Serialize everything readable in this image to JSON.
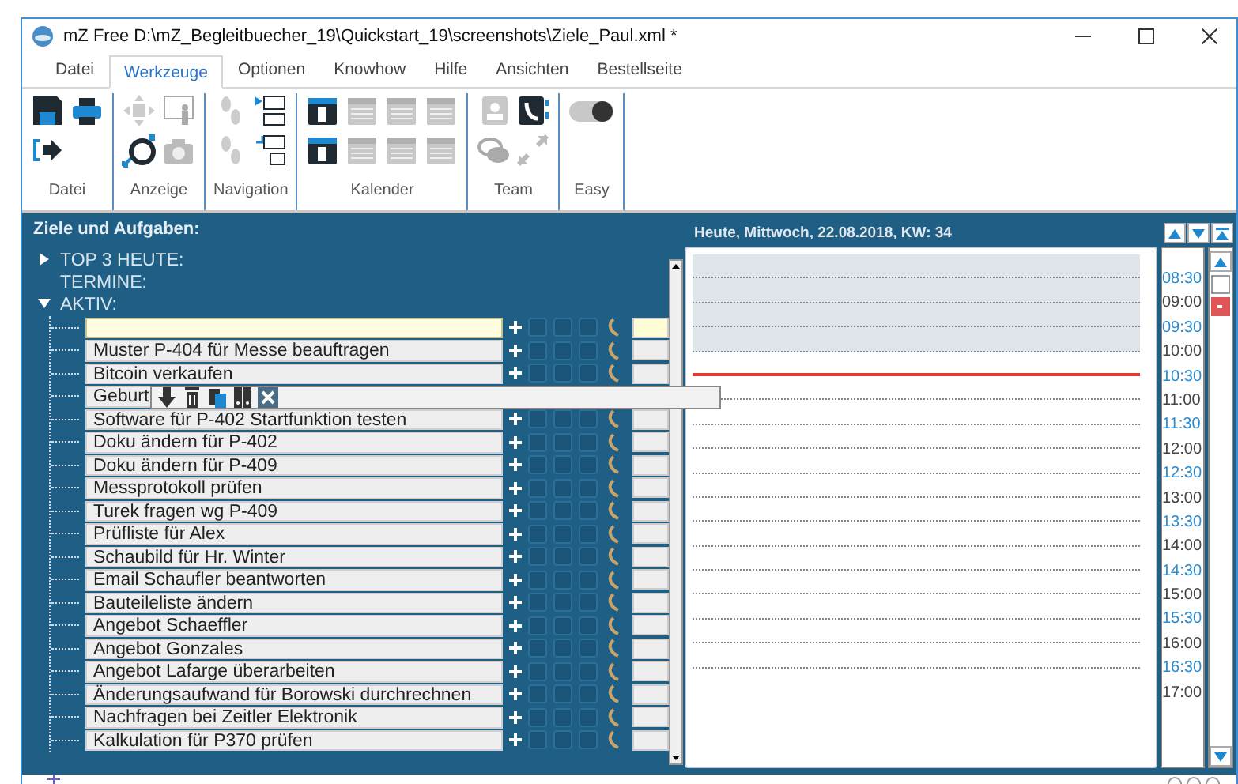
{
  "window": {
    "title": "mZ Free D:\\mZ_Begleitbuecher_19\\Quickstart_19\\screenshots\\Ziele_Paul.xml *"
  },
  "tabs": [
    {
      "label": "Datei",
      "selected": false
    },
    {
      "label": "Werkzeuge",
      "selected": true
    },
    {
      "label": "Optionen",
      "selected": false
    },
    {
      "label": "Knowhow",
      "selected": false
    },
    {
      "label": "Hilfe",
      "selected": false
    },
    {
      "label": "Ansichten",
      "selected": false
    },
    {
      "label": "Bestellseite",
      "selected": false
    }
  ],
  "ribbon": [
    {
      "label": "Datei",
      "kind": "datei"
    },
    {
      "label": "Anzeige",
      "kind": "anzeige"
    },
    {
      "label": "Navigation",
      "kind": "navigation"
    },
    {
      "label": "Kalender",
      "kind": "kalender"
    },
    {
      "label": "Team",
      "kind": "team"
    },
    {
      "label": "Easy",
      "kind": "easy",
      "on": false
    }
  ],
  "goals": {
    "title": "Ziele und Aufgaben:",
    "tree": [
      {
        "label": "TOP 3 HEUTE:",
        "kind": "branch",
        "expanded": false
      },
      {
        "label": "TERMINE:",
        "kind": "leaf"
      },
      {
        "label": "AKTIV:",
        "kind": "branch",
        "expanded": true,
        "children": [
          {
            "focused": true,
            "menu_open": false
          },
          {
            "text": "Muster P-404 für Messe beauftragen",
            "focused": false,
            "menu_open": false
          },
          {
            "text": "Bitcoin verkaufen",
            "focused": false,
            "menu_open": false
          },
          {
            "text": "Geburt",
            "focused": false,
            "menu_open": true
          },
          {
            "text": "Software für P-402 Startfunktion testen",
            "focused": false,
            "menu_open": false
          },
          {
            "text": "Doku ändern für P-402",
            "focused": false,
            "menu_open": false
          },
          {
            "text": "Doku ändern für P-409",
            "focused": false,
            "menu_open": false
          },
          {
            "text": "Messprotokoll prüfen",
            "focused": false,
            "menu_open": false
          },
          {
            "text": "Turek fragen wg P-409",
            "focused": false,
            "menu_open": false
          },
          {
            "text": "Prüfliste für Alex",
            "focused": false,
            "menu_open": false
          },
          {
            "text": "Schaubild für Hr. Winter",
            "focused": false,
            "menu_open": false
          },
          {
            "text": "Email Schaufler beantworten",
            "focused": false,
            "menu_open": false
          },
          {
            "text": "Bauteileliste ändern",
            "focused": false,
            "menu_open": false
          },
          {
            "text": "Angebot Schaeffler",
            "focused": false,
            "menu_open": false
          },
          {
            "text": "Angebot Gonzales",
            "focused": false,
            "menu_open": false
          },
          {
            "text": "Angebot Lafarge überarbeiten",
            "focused": false,
            "menu_open": false
          },
          {
            "text": "Änderungsaufwand für Borowski durchrechnen",
            "focused": false,
            "menu_open": false
          },
          {
            "text": "Nachfragen bei Zeitler Elektronik",
            "focused": false,
            "menu_open": false
          },
          {
            "text": "Kalkulation für P370 prüfen",
            "focused": false,
            "menu_open": false
          }
        ]
      }
    ]
  },
  "calendar": {
    "header": "Heute, Mittwoch, 22.08.2018, KW: 34",
    "slots": [
      {
        "time": "08:30",
        "kind": "half",
        "past": true,
        "now": false
      },
      {
        "time": "09:00",
        "kind": "hour",
        "past": true,
        "now": false
      },
      {
        "time": "09:30",
        "kind": "half",
        "past": true,
        "now": false
      },
      {
        "time": "10:00",
        "kind": "hour",
        "past": true,
        "now": false
      },
      {
        "time": "10:30",
        "kind": "half",
        "past": false,
        "now": true
      },
      {
        "time": "11:00",
        "kind": "hour",
        "past": false,
        "now": false
      },
      {
        "time": "11:30",
        "kind": "half",
        "past": false,
        "now": false
      },
      {
        "time": "12:00",
        "kind": "hour",
        "past": false,
        "now": false
      },
      {
        "time": "12:30",
        "kind": "half",
        "past": false,
        "now": false
      },
      {
        "time": "13:00",
        "kind": "hour",
        "past": false,
        "now": false
      },
      {
        "time": "13:30",
        "kind": "half",
        "past": false,
        "now": false
      },
      {
        "time": "14:00",
        "kind": "hour",
        "past": false,
        "now": false
      },
      {
        "time": "14:30",
        "kind": "half",
        "past": false,
        "now": false
      },
      {
        "time": "15:00",
        "kind": "hour",
        "past": false,
        "now": false
      },
      {
        "time": "15:30",
        "kind": "half",
        "past": false,
        "now": false
      },
      {
        "time": "16:00",
        "kind": "hour",
        "past": false,
        "now": false
      },
      {
        "time": "16:30",
        "kind": "half",
        "past": false,
        "now": false
      },
      {
        "time": "17:00",
        "kind": "hour",
        "past": false,
        "now": false
      }
    ]
  }
}
